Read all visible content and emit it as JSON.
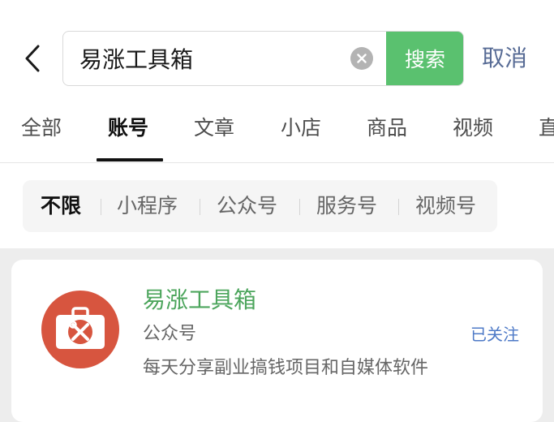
{
  "search": {
    "query": "易涨工具箱",
    "button_label": "搜索",
    "cancel_label": "取消"
  },
  "tabs": [
    {
      "label": "全部",
      "active": false
    },
    {
      "label": "账号",
      "active": true
    },
    {
      "label": "文章",
      "active": false
    },
    {
      "label": "小店",
      "active": false
    },
    {
      "label": "商品",
      "active": false
    },
    {
      "label": "视频",
      "active": false
    },
    {
      "label": "直",
      "active": false
    }
  ],
  "filters": [
    {
      "label": "不限",
      "active": true
    },
    {
      "label": "小程序",
      "active": false
    },
    {
      "label": "公众号",
      "active": false
    },
    {
      "label": "服务号",
      "active": false
    },
    {
      "label": "视频号",
      "active": false
    }
  ],
  "result": {
    "name": "易涨工具箱",
    "type": "公众号",
    "description": "每天分享副业搞钱项目和自媒体软件",
    "follow_status": "已关注",
    "avatar_icon": "toolbox-icon"
  },
  "colors": {
    "accent_green": "#5ac16f",
    "name_green": "#4ca55c",
    "link_blue": "#576b95",
    "follow_blue": "#4e7ac7",
    "avatar_red": "#d7553f"
  }
}
